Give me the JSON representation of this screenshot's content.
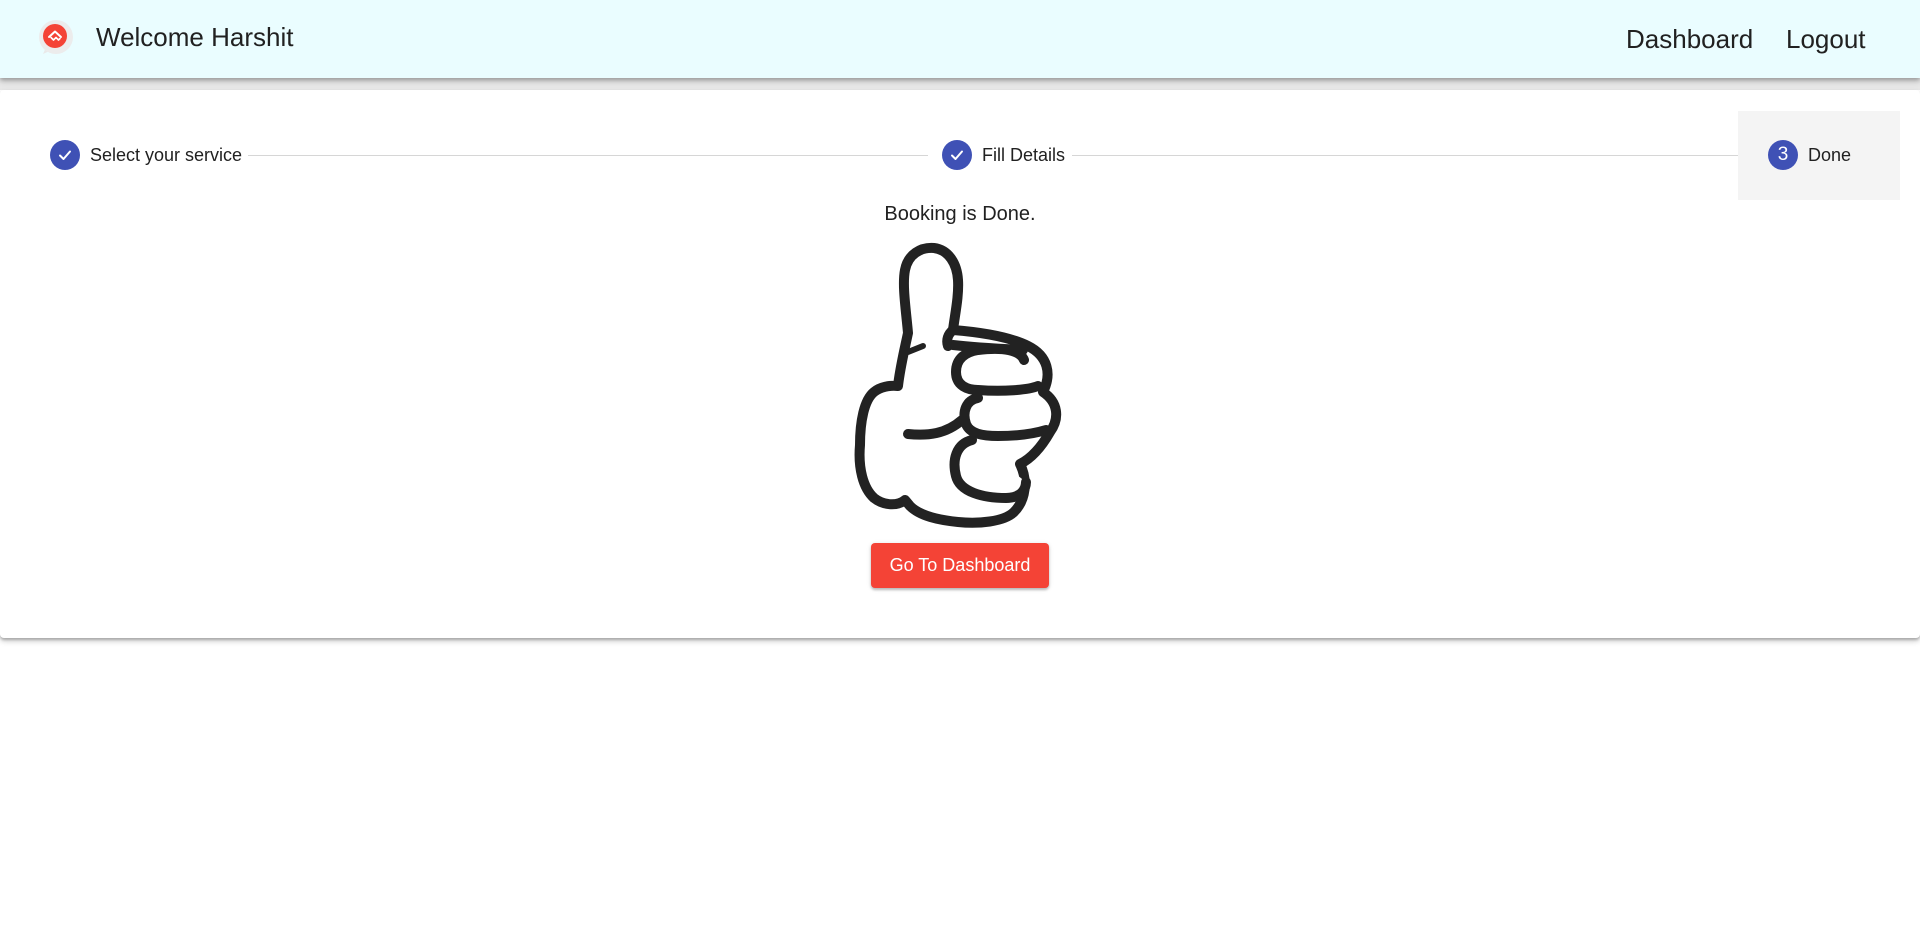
{
  "header": {
    "welcome_text": "Welcome Harshit",
    "nav": {
      "dashboard": "Dashboard",
      "logout": "Logout"
    },
    "background_color": "#eafdff",
    "logo_icon": "home-pin-logo-icon",
    "logo_color": "#f44336"
  },
  "stepper": {
    "steps": [
      {
        "label": "Select your service",
        "status": "completed",
        "icon": "check-icon"
      },
      {
        "label": "Fill Details",
        "status": "completed",
        "icon": "check-icon"
      },
      {
        "label": "Done",
        "status": "active",
        "number": "3"
      }
    ],
    "accent_color": "#3f51b5"
  },
  "main": {
    "message": "Booking is Done.",
    "illustration": "thumbs-up-icon",
    "button_label": "Go To Dashboard",
    "button_color": "#f44336"
  }
}
